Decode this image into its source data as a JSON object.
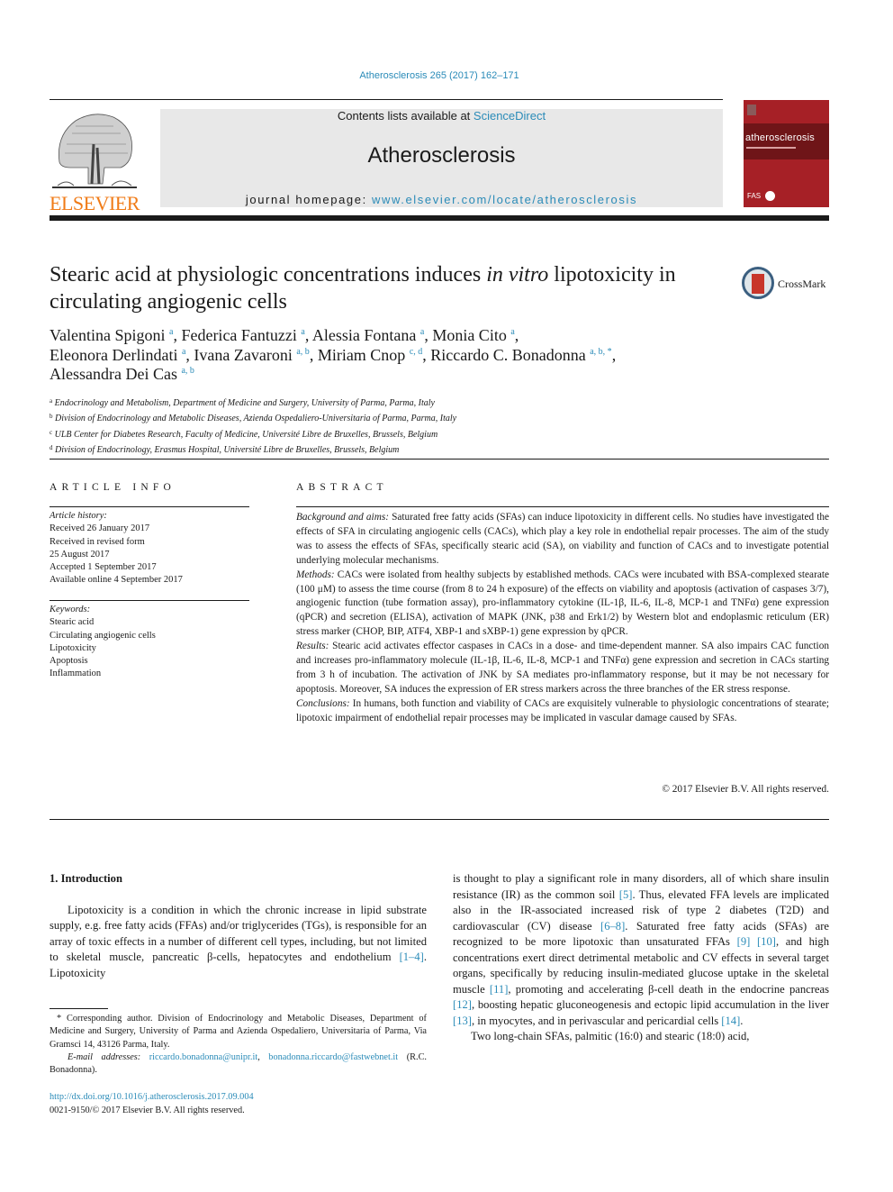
{
  "header": {
    "citation": "Atherosclerosis 265 (2017) 162–171",
    "publisher_logo_text": "ELSEVIER",
    "contents_prefix": "Contents lists available at ",
    "contents_link": "ScienceDirect",
    "journal_name": "Atherosclerosis",
    "homepage_prefix": "journal homepage: ",
    "homepage_link": "www.elsevier.com/locate/atherosclerosis",
    "cover_title": "atherosclerosis",
    "cover_badge": "FAS",
    "colors": {
      "link": "#2a8bb8",
      "elsevier_orange": "#f07b17",
      "cover_red": "#a62026",
      "banner_gray": "#e8e8e8"
    }
  },
  "article": {
    "title_part1": "Stearic acid at physiologic concentrations induces ",
    "title_italic": "in vitro",
    "title_part2": " lipotoxicity in circulating angiogenic cells",
    "crossmark_label": "CrossMark",
    "authors": [
      {
        "name": "Valentina Spigoni",
        "aff": "a",
        "sep": ", "
      },
      {
        "name": "Federica Fantuzzi",
        "aff": "a",
        "sep": ", "
      },
      {
        "name": "Alessia Fontana",
        "aff": "a",
        "sep": ", "
      },
      {
        "name": "Monia Cito",
        "aff": "a",
        "sep": ","
      },
      {
        "name": "Eleonora Derlindati",
        "aff": "a",
        "sep": ", "
      },
      {
        "name": "Ivana Zavaroni",
        "aff": "a, b",
        "sep": ", "
      },
      {
        "name": "Miriam Cnop",
        "aff": "c, d",
        "sep": ", "
      },
      {
        "name": "Riccardo C. Bonadonna",
        "aff": "a, b, *",
        "sep": ","
      },
      {
        "name": "Alessandra Dei Cas",
        "aff": "a, b",
        "sep": ""
      }
    ],
    "affiliations": [
      {
        "key": "a",
        "text": "Endocrinology and Metabolism, Department of Medicine and Surgery, University of Parma, Parma, Italy"
      },
      {
        "key": "b",
        "text": "Division of Endocrinology and Metabolic Diseases, Azienda Ospedaliero-Universitaria of Parma, Parma, Italy"
      },
      {
        "key": "c",
        "text": "ULB Center for Diabetes Research, Faculty of Medicine, Université Libre de Bruxelles, Brussels, Belgium"
      },
      {
        "key": "d",
        "text": "Division of Endocrinology, Erasmus Hospital, Université Libre de Bruxelles, Brussels, Belgium"
      }
    ]
  },
  "article_info": {
    "heading": "ARTICLE INFO",
    "history_label": "Article history:",
    "history": [
      "Received 26 January 2017",
      "Received in revised form",
      "25 August 2017",
      "Accepted 1 September 2017",
      "Available online 4 September 2017"
    ],
    "keywords_label": "Keywords:",
    "keywords": [
      "Stearic acid",
      "Circulating angiogenic cells",
      "Lipotoxicity",
      "Apoptosis",
      "Inflammation"
    ]
  },
  "abstract": {
    "heading": "ABSTRACT",
    "sections": [
      {
        "label": "Background and aims:",
        "text": " Saturated free fatty acids (SFAs) can induce lipotoxicity in different cells. No studies have investigated the effects of SFA in circulating angiogenic cells (CACs), which play a key role in endothelial repair processes. The aim of the study was to assess the effects of SFAs, specifically stearic acid (SA), on viability and function of CACs and to investigate potential underlying molecular mechanisms."
      },
      {
        "label": "Methods:",
        "text": " CACs were isolated from healthy subjects by established methods. CACs were incubated with BSA-complexed stearate (100 μM) to assess the time course (from 8 to 24 h exposure) of the effects on viability and apoptosis (activation of caspases 3/7), angiogenic function (tube formation assay), pro-inflammatory cytokine (IL-1β, IL-6, IL-8, MCP-1 and TNFα) gene expression (qPCR) and secretion (ELISA), activation of MAPK (JNK, p38 and Erk1/2) by Western blot and endoplasmic reticulum (ER) stress marker (CHOP, BIP, ATF4, XBP-1 and sXBP-1) gene expression by qPCR."
      },
      {
        "label": "Results:",
        "text": " Stearic acid activates effector caspases in CACs in a dose- and time-dependent manner. SA also impairs CAC function and increases pro-inflammatory molecule (IL-1β, IL-6, IL-8, MCP-1 and TNFα) gene expression and secretion in CACs starting from 3 h of incubation. The activation of JNK by SA mediates pro-inflammatory response, but it may be not necessary for apoptosis. Moreover, SA induces the expression of ER stress markers across the three branches of the ER stress response."
      },
      {
        "label": "Conclusions:",
        "text": " In humans, both function and viability of CACs are exquisitely vulnerable to physiologic concentrations of stearate; lipotoxic impairment of endothelial repair processes may be implicated in vascular damage caused by SFAs."
      }
    ],
    "copyright": "© 2017 Elsevier B.V. All rights reserved."
  },
  "body": {
    "section_title": "1.  Introduction",
    "left_paragraph": [
      {
        "t": "Lipotoxicity is a condition in which the chronic increase in lipid substrate supply, e.g. free fatty acids (FFAs) and/or triglycerides (TGs), is responsible for an array of toxic effects in a number of different cell types, including, but not limited to skeletal muscle, pancreatic β-cells, hepatocytes and endothelium "
      },
      {
        "ref": "[1–4]"
      },
      {
        "t": ". Lipotoxicity"
      }
    ],
    "right_paragraph1": [
      {
        "t": "is thought to play a significant role in many disorders, all of which share insulin resistance (IR) as the common soil "
      },
      {
        "ref": "[5]"
      },
      {
        "t": ". Thus, elevated FFA levels are implicated also in the IR-associated increased risk of type 2 diabetes (T2D) and cardiovascular (CV) disease "
      },
      {
        "ref": "[6–8]"
      },
      {
        "t": ". Saturated free fatty acids (SFAs) are recognized to be more lipotoxic than unsaturated FFAs "
      },
      {
        "ref": "[9]"
      },
      {
        "t": " "
      },
      {
        "ref": "[10]"
      },
      {
        "t": ", and high concentrations exert direct detrimental metabolic and CV effects in several target organs, specifically by reducing insulin-mediated glucose uptake in the skeletal muscle "
      },
      {
        "ref": "[11]"
      },
      {
        "t": ", promoting and accelerating β-cell death in the endocrine pancreas "
      },
      {
        "ref": "[12]"
      },
      {
        "t": ", boosting hepatic gluconeogenesis and ectopic lipid accumulation in the liver "
      },
      {
        "ref": "[13]"
      },
      {
        "t": ", in myocytes, and in perivascular and pericardial cells "
      },
      {
        "ref": "[14]"
      },
      {
        "t": "."
      }
    ],
    "right_paragraph2": "Two long-chain SFAs, palmitic (16:0) and stearic (18:0) acid,"
  },
  "footnote": {
    "corresponding": "* Corresponding author. Division of Endocrinology and Metabolic Diseases, Department of Medicine and Surgery, University of Parma and Azienda Ospedaliero, Universitaria of Parma, Via Gramsci 14, 43126 Parma, Italy.",
    "email_label": "E-mail addresses:",
    "email1": "riccardo.bonadonna@unipr.it",
    "email2": "bonadonna.riccardo@fastwebnet.it",
    "email_owner": " (R.C. Bonadonna).",
    "doi": "http://dx.doi.org/10.1016/j.atherosclerosis.2017.09.004",
    "issn": "0021-9150/© 2017 Elsevier B.V. All rights reserved."
  }
}
